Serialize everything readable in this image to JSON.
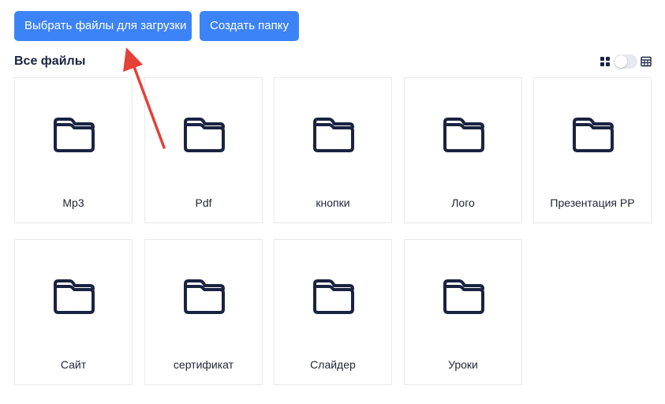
{
  "toolbar": {
    "upload_label": "Выбрать файлы для загрузки",
    "create_folder_label": "Создать папку"
  },
  "section": {
    "title": "Все файлы"
  },
  "view_toggle": {
    "mode": "grid",
    "icons": [
      "grid-icon",
      "table-icon"
    ]
  },
  "folders": [
    {
      "label": "Mp3",
      "icon": "folder-icon"
    },
    {
      "label": "Pdf",
      "icon": "folder-icon"
    },
    {
      "label": "кнопки",
      "icon": "folder-icon"
    },
    {
      "label": "Лого",
      "icon": "folder-icon"
    },
    {
      "label": "Презентация PP",
      "icon": "folder-icon"
    },
    {
      "label": "Сайт",
      "icon": "folder-icon"
    },
    {
      "label": "сертификат",
      "icon": "folder-icon"
    },
    {
      "label": "Слайдер",
      "icon": "folder-icon"
    },
    {
      "label": "Уроки",
      "icon": "folder-icon"
    }
  ],
  "annotation": {
    "icon": "red-arrow-icon",
    "color": "#e5403a"
  },
  "colors": {
    "accent": "#3d83f8",
    "text": "#1a2340",
    "border": "#e8e9ee"
  }
}
